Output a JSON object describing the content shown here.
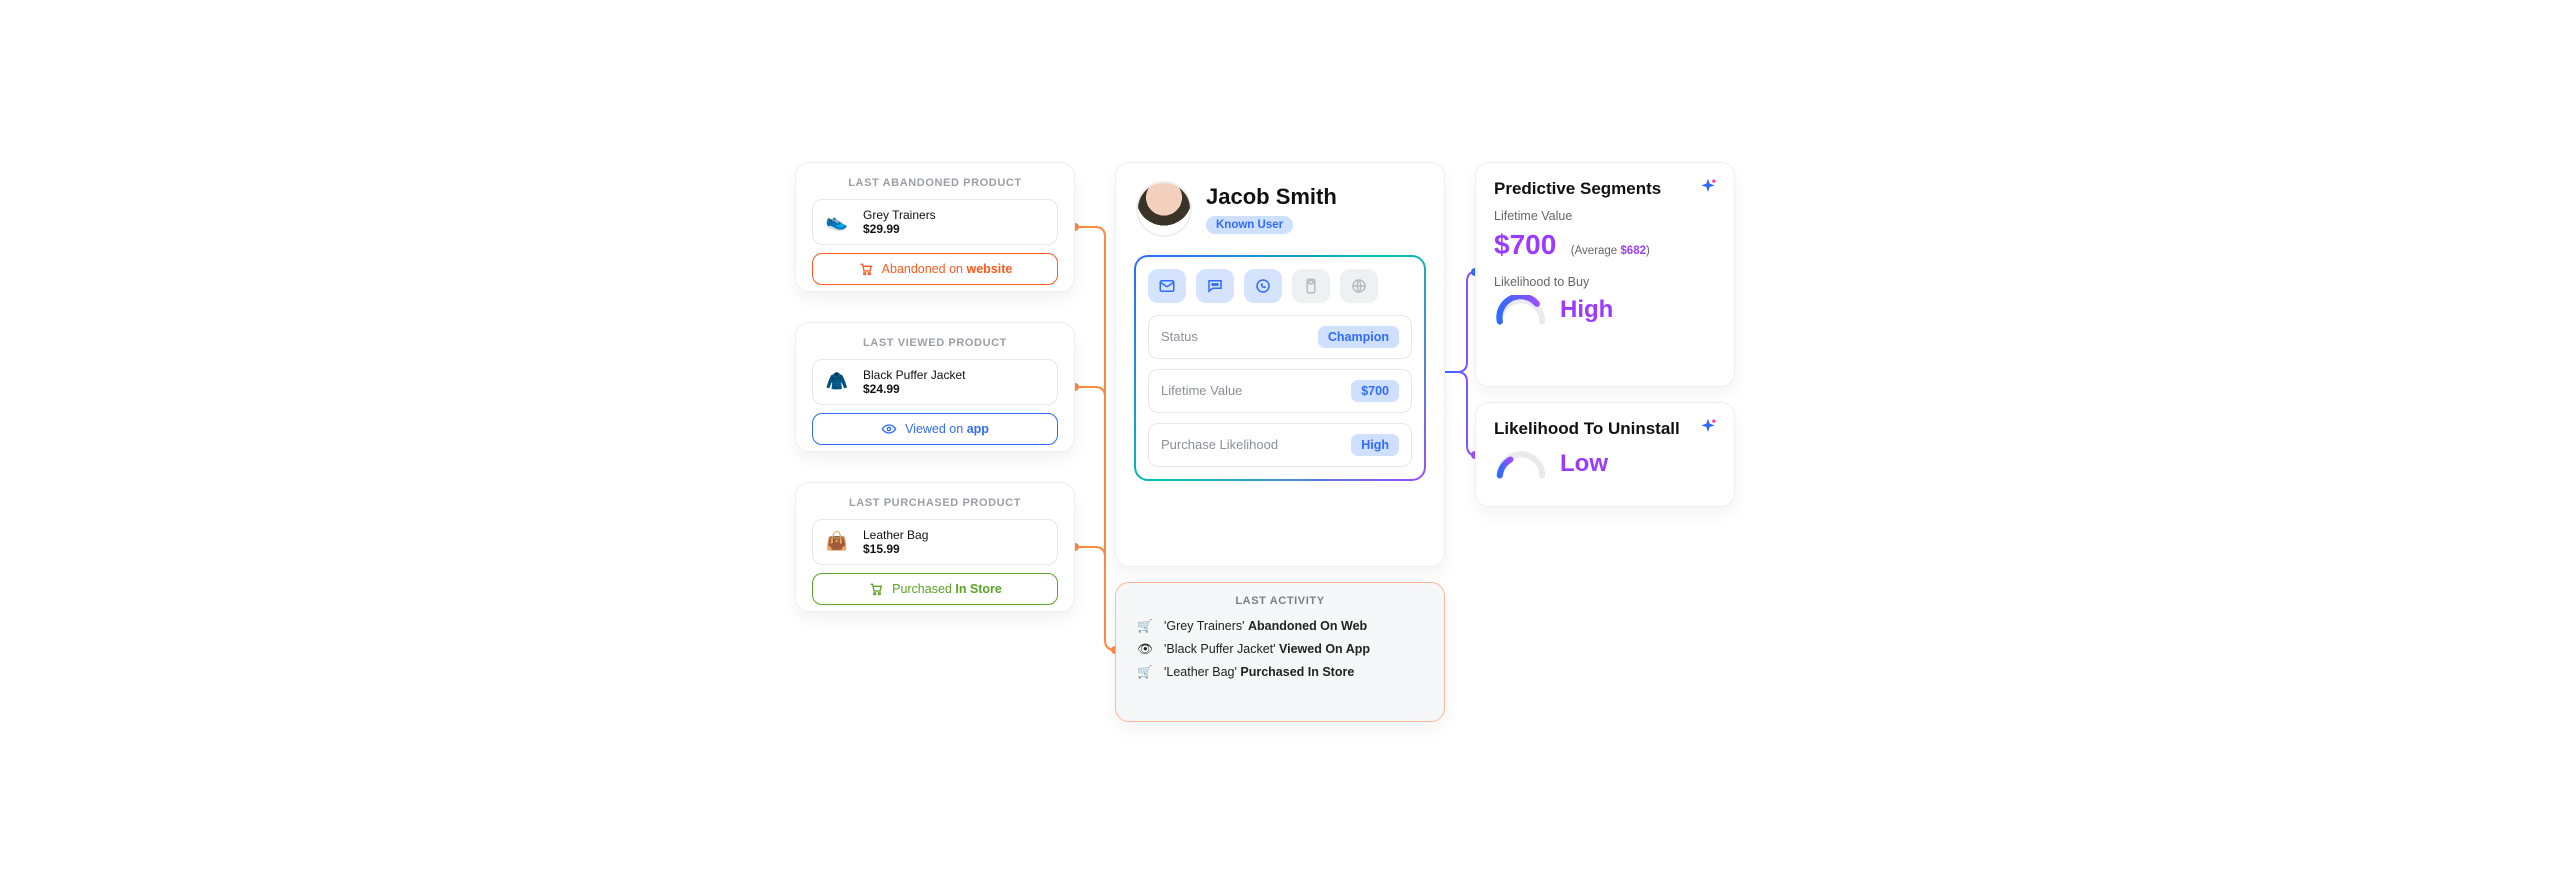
{
  "left": {
    "abandoned": {
      "title": "LAST ABANDONED PRODUCT",
      "name": "Grey Trainers",
      "price": "$29.99",
      "pill_pre": "Abandoned on ",
      "pill_bold": "website"
    },
    "viewed": {
      "title": "LAST VIEWED PRODUCT",
      "name": "Black Puffer Jacket",
      "price": "$24.99",
      "pill_pre": "Viewed on ",
      "pill_bold": "app"
    },
    "purchased": {
      "title": "LAST PURCHASED PRODUCT",
      "name": "Leather Bag",
      "price": "$15.99",
      "pill_pre": "Purchased ",
      "pill_bold": "In Store"
    }
  },
  "profile": {
    "name": "Jacob Smith",
    "tag": "Known User",
    "rows": {
      "status_label": "Status",
      "status_value": "Champion",
      "ltv_label": "Lifetime Value",
      "ltv_value": "$700",
      "pl_label": "Purchase Likelihood",
      "pl_value": "High"
    }
  },
  "activity": {
    "title": "LAST ACTIVITY",
    "items": [
      {
        "product": "'Grey Trainers' ",
        "action": "Abandoned On Web"
      },
      {
        "product": "'Black Puffer Jacket' ",
        "action": "Viewed On App"
      },
      {
        "product": "'Leather Bag' ",
        "action": "Purchased In Store"
      }
    ]
  },
  "predictive": {
    "title": "Predictive Segments",
    "ltv_label": "Lifetime Value",
    "ltv_value": "$700",
    "avg_pre": "(Average ",
    "avg_val": "$682",
    "avg_post": ")",
    "lb_label": "Likelihood to Buy",
    "lb_value": "High",
    "uninstall_title": "Likelihood To Uninstall",
    "uninstall_value": "Low"
  }
}
